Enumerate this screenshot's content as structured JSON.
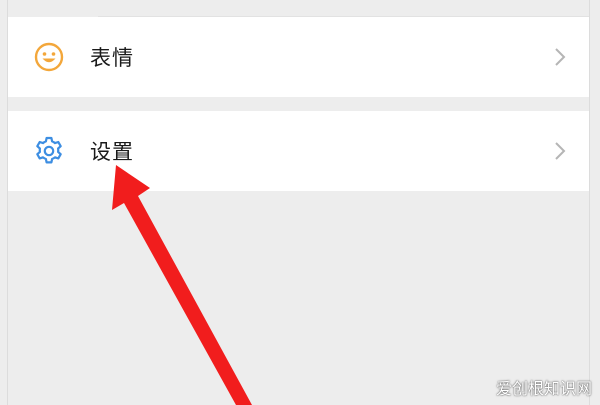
{
  "menu": {
    "emoji_row": {
      "label": "表情",
      "icon": "smiley-icon",
      "accent": "#f3a73b"
    },
    "settings_row": {
      "label": "设置",
      "icon": "gear-icon",
      "accent": "#3d8ee2"
    }
  },
  "annotation": {
    "arrow_color": "#f11d1d"
  },
  "watermark": {
    "text": "爱创根知识网"
  }
}
